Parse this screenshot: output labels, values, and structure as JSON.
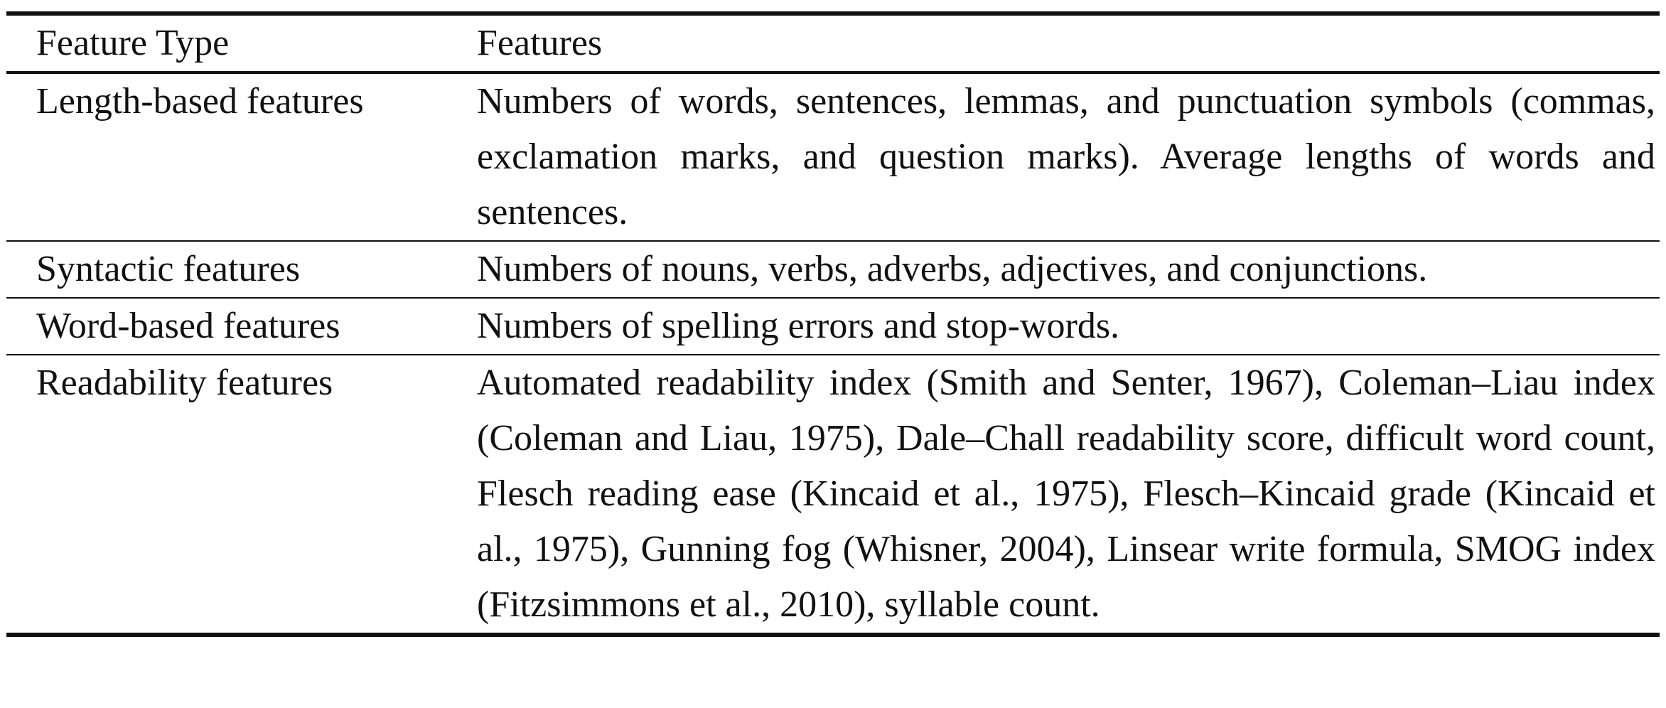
{
  "table": {
    "headers": [
      "Feature Type",
      "Features"
    ],
    "rows": [
      {
        "type": "Length-based features",
        "features": "Numbers of words, sentences, lemmas, and punctuation sym­bols (commas, exclamation marks, and question marks). Average lengths of words and sentences."
      },
      {
        "type": "Syntactic features",
        "features": "Numbers of nouns, verbs, adverbs, adjectives, and conjunctions."
      },
      {
        "type": "Word-based features",
        "features": "Numbers of spelling errors and stop-words."
      },
      {
        "type": "Readability features",
        "features": "Automated readability index (Smith and Senter, 1967), Coleman–Liau index (Coleman and Liau, 1975), Dale–Chall readabil­ity score, difficult word count, Flesch reading ease (Kincaid et al., 1975), Flesch–Kincaid grade (Kincaid et al., 1975), Gun­ning fog (Whisner, 2004), Linsear write formula, SMOG in­dex (Fitzsimmons et al., 2010), syllable count."
      }
    ]
  }
}
